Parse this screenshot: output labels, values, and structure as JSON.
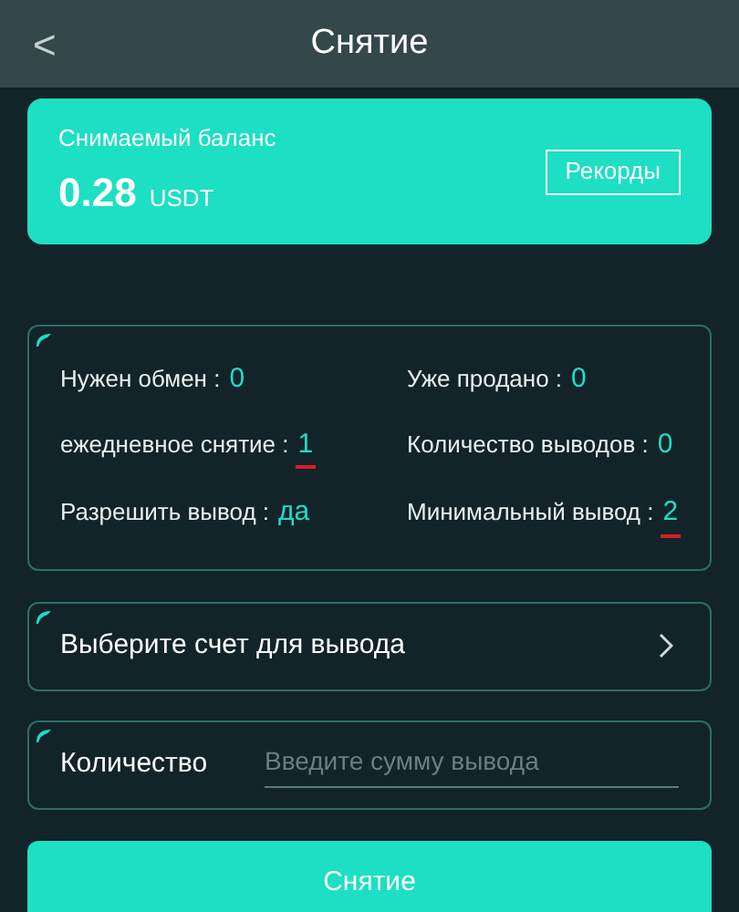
{
  "header": {
    "back": "<",
    "title": "Снятие"
  },
  "balance": {
    "label": "Снимаемый баланс",
    "amount": "0.28",
    "unit": "USDT",
    "records_button": "Рекорды"
  },
  "stats": [
    {
      "label": "Нужен обмен :",
      "value": "0",
      "marked": false
    },
    {
      "label": "Уже продано :",
      "value": "0",
      "marked": false
    },
    {
      "label": "ежедневное снятие :",
      "value": "1",
      "marked": true
    },
    {
      "label": "Количество выводов :",
      "value": "0",
      "marked": false
    },
    {
      "label": "Разрешить вывод :",
      "value": "да",
      "marked": false
    },
    {
      "label": "Минимальный вывод :",
      "value": "2",
      "marked": true
    }
  ],
  "account_select": {
    "label": "Выберите счет для вывода"
  },
  "amount": {
    "label": "Количество",
    "placeholder": "Введите сумму вывода"
  },
  "submit_button": "Снятие"
}
